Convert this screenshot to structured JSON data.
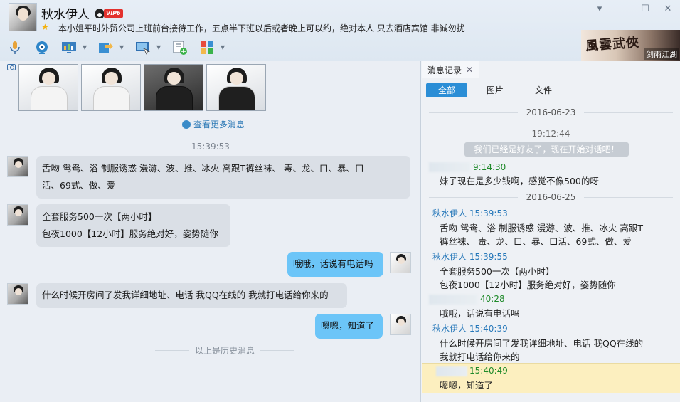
{
  "header": {
    "contact_name": "秋水伊人",
    "vip_label": "VIP6",
    "signature": "本小姐平时外贸公司上班前台接待工作，五点半下班以后或者晚上可以约，绝对本人 只去酒店宾馆 非诚勿扰",
    "banner_title": "風雲武俠",
    "banner_sub": "剑雨江湖"
  },
  "chat": {
    "more_link": "查看更多消息",
    "timestamp": "15:39:53",
    "messages": [
      {
        "side": "left",
        "lines": [
          "舌吻  鸳鸯、浴 制服诱惑 漫游、波、推、冰火 高跟T裤丝袜、 毒、龙、口、暴、口",
          "活、69式、做、爱"
        ]
      },
      {
        "side": "left",
        "lines": [
          "全套服务500一次【两小时】",
          "包夜1000【12小时】服务绝对好，姿势随你"
        ]
      },
      {
        "side": "right",
        "lines": [
          "哦哦，话说有电话吗"
        ]
      },
      {
        "side": "left",
        "lines": [
          "什么时候开房间了发我详细地址、电话 我QQ在线的 我就打电话给你来的"
        ]
      },
      {
        "side": "right",
        "lines": [
          "嗯嗯，知道了"
        ]
      }
    ],
    "history_label": "以上是历史消息"
  },
  "record": {
    "tab_label": "消息记录",
    "filters": [
      "全部",
      "图片",
      "文件"
    ],
    "date1": "2016-06-23",
    "time1": "19:12:44",
    "friend_notice": "我们已经是好友了，现在开始对话吧！",
    "entries": [
      {
        "sender": "",
        "time": "9:14:30",
        "text": [
          "妹子现在是多少钱啊，感觉不像500的呀"
        ]
      },
      {
        "sender": "秋水伊人",
        "time": "15:39:53",
        "text": [
          "舌吻  鸳鸯、浴 制服诱惑 漫游、波、推、冰火 高跟T",
          "裤丝袜、 毒、龙、口、暴、口活、69式、做、爱"
        ]
      },
      {
        "sender": "秋水伊人",
        "time": "15:39:55",
        "text": [
          "全套服务500一次【两小时】",
          "包夜1000【12小时】服务绝对好，姿势随你"
        ]
      },
      {
        "sender": "",
        "time": "40:28",
        "text": [
          "哦哦，话说有电话吗"
        ]
      },
      {
        "sender": "秋水伊人",
        "time": "15:40:39",
        "text": [
          "什么时候开房间了发我详细地址、电话 我QQ在线的",
          " 我就打电话给你来的"
        ]
      },
      {
        "sender": "",
        "time": "15:40:49",
        "text": [
          "嗯嗯，知道了"
        ]
      }
    ],
    "date2": "2016-06-25"
  },
  "icons": {
    "toolbar": [
      "microphone-icon",
      "camera-icon",
      "screen-share-icon",
      "file-transfer-icon",
      "remote-desktop-icon",
      "add-message-icon",
      "apps-icon"
    ],
    "accent": "#2b8ed6",
    "bubble_self": "#6cc5f8",
    "bubble_other": "#dadfe6"
  }
}
